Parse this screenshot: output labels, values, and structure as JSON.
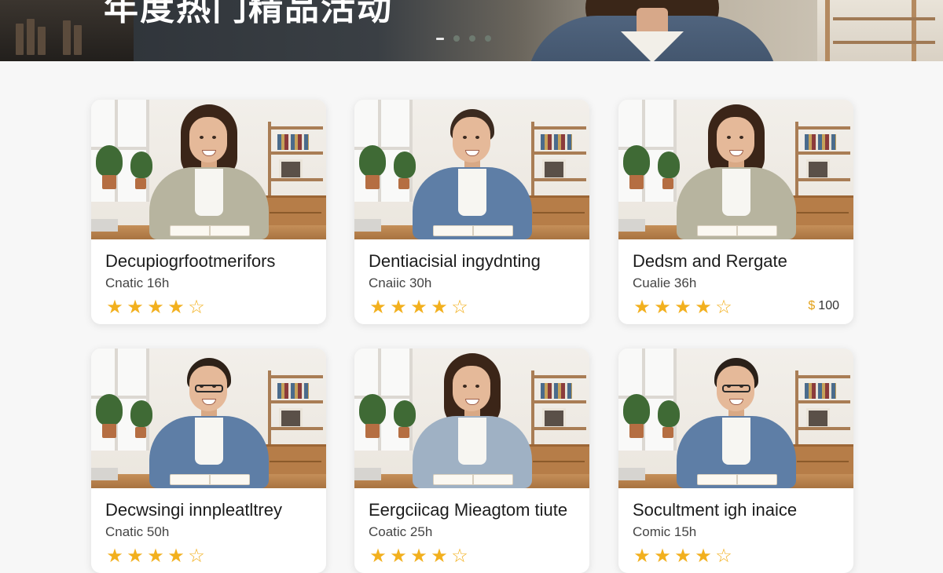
{
  "banner": {
    "title": "年度热门精品活动",
    "dots": [
      "active",
      "inactive",
      "inactive",
      "inactive"
    ]
  },
  "colors": {
    "star": "#f2b01e",
    "price_symbol": "#e3a21b",
    "card_bg": "#ffffff",
    "page_bg": "#f7f7f7"
  },
  "cards": [
    {
      "title": "Decupiogrfootmerifors",
      "meta": "Cnatic 16h",
      "rating": 4,
      "rating_max": 5,
      "price_symbol": "",
      "price": "",
      "person": {
        "hair": "#3b2518",
        "shirt": "#b7b49f",
        "glasses": false,
        "short_hair": false
      }
    },
    {
      "title": "Dentiacisial ingydnting",
      "meta": "Cnaiic 30h",
      "rating": 4,
      "rating_max": 5,
      "price_symbol": "",
      "price": "",
      "person": {
        "hair": "#3b2a1f",
        "shirt": "#5e7ea6",
        "glasses": false,
        "short_hair": true
      }
    },
    {
      "title": "Dedsm and Rergate",
      "meta": "Cualie 36h",
      "rating": 4,
      "rating_max": 5,
      "price_symbol": "$",
      "price": "100",
      "person": {
        "hair": "#3b2518",
        "shirt": "#b7b49f",
        "glasses": false,
        "short_hair": false
      }
    },
    {
      "title": "Decwsingi innpleatltrey",
      "meta": "Cnatic 50h",
      "rating": 4,
      "rating_max": 5,
      "price_symbol": "",
      "price": "",
      "person": {
        "hair": "#2d2118",
        "shirt": "#5e7ea6",
        "glasses": true,
        "short_hair": true
      }
    },
    {
      "title": "Eergciicag Mieagtom tiute",
      "meta": "Coatic 25h",
      "rating": 4,
      "rating_max": 5,
      "price_symbol": "",
      "price": "",
      "person": {
        "hair": "#3b2518",
        "shirt": "#9fb1c4",
        "glasses": false,
        "short_hair": false
      }
    },
    {
      "title": "Socultment igh inaice",
      "meta": "Comic 15h",
      "rating": 4,
      "rating_max": 5,
      "price_symbol": "",
      "price": "",
      "person": {
        "hair": "#2a2019",
        "shirt": "#5e7ea6",
        "glasses": true,
        "short_hair": true
      }
    }
  ]
}
